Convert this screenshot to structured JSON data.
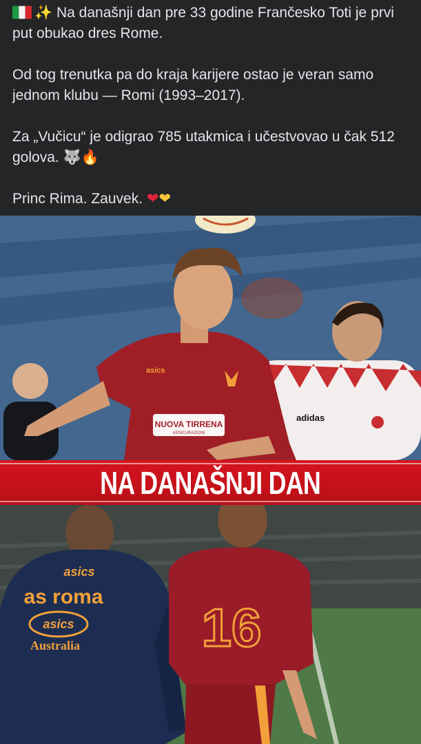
{
  "caption": {
    "line1": "Na današnji dan pre 33 godine Frančesko Toti je prvi put obukao dres Rome.",
    "line2": "Od tog trenutka pa do kraja karijere ostao je veran samo jednom klubu — Romi (1993–2017).",
    "line3": "Za „Vučicu“ je odigrao 785 utakmica i učestvovao u čak 512 golova.",
    "line4": "Princ Rima. Zauvek.",
    "emoji": {
      "flag_icon": "italy-flag-icon",
      "sparkles": "✨",
      "wolf": "🐺",
      "fire": "🔥",
      "red_heart": "❤",
      "yellow_heart": "💛"
    }
  },
  "banner": {
    "text": "NA DANAŠNJI DAN",
    "color": "#d6141d"
  },
  "photo_top": {
    "sponsor": "NUOVA TIRRENA",
    "sponsor_sub": "ASSICURAZIONI",
    "kit_brand": "asics",
    "opponent_brand": "adidas"
  },
  "photo_bottom": {
    "jacket_brand": "asics",
    "jacket_club": "as roma",
    "jacket_logo": "asics",
    "jacket_country": "Australia",
    "shirt_number": "16"
  },
  "colors": {
    "caption_bg": "#242526",
    "caption_text": "#e4e6eb",
    "roma_red": "#9e1b24",
    "roma_orange": "#f2a13a"
  }
}
